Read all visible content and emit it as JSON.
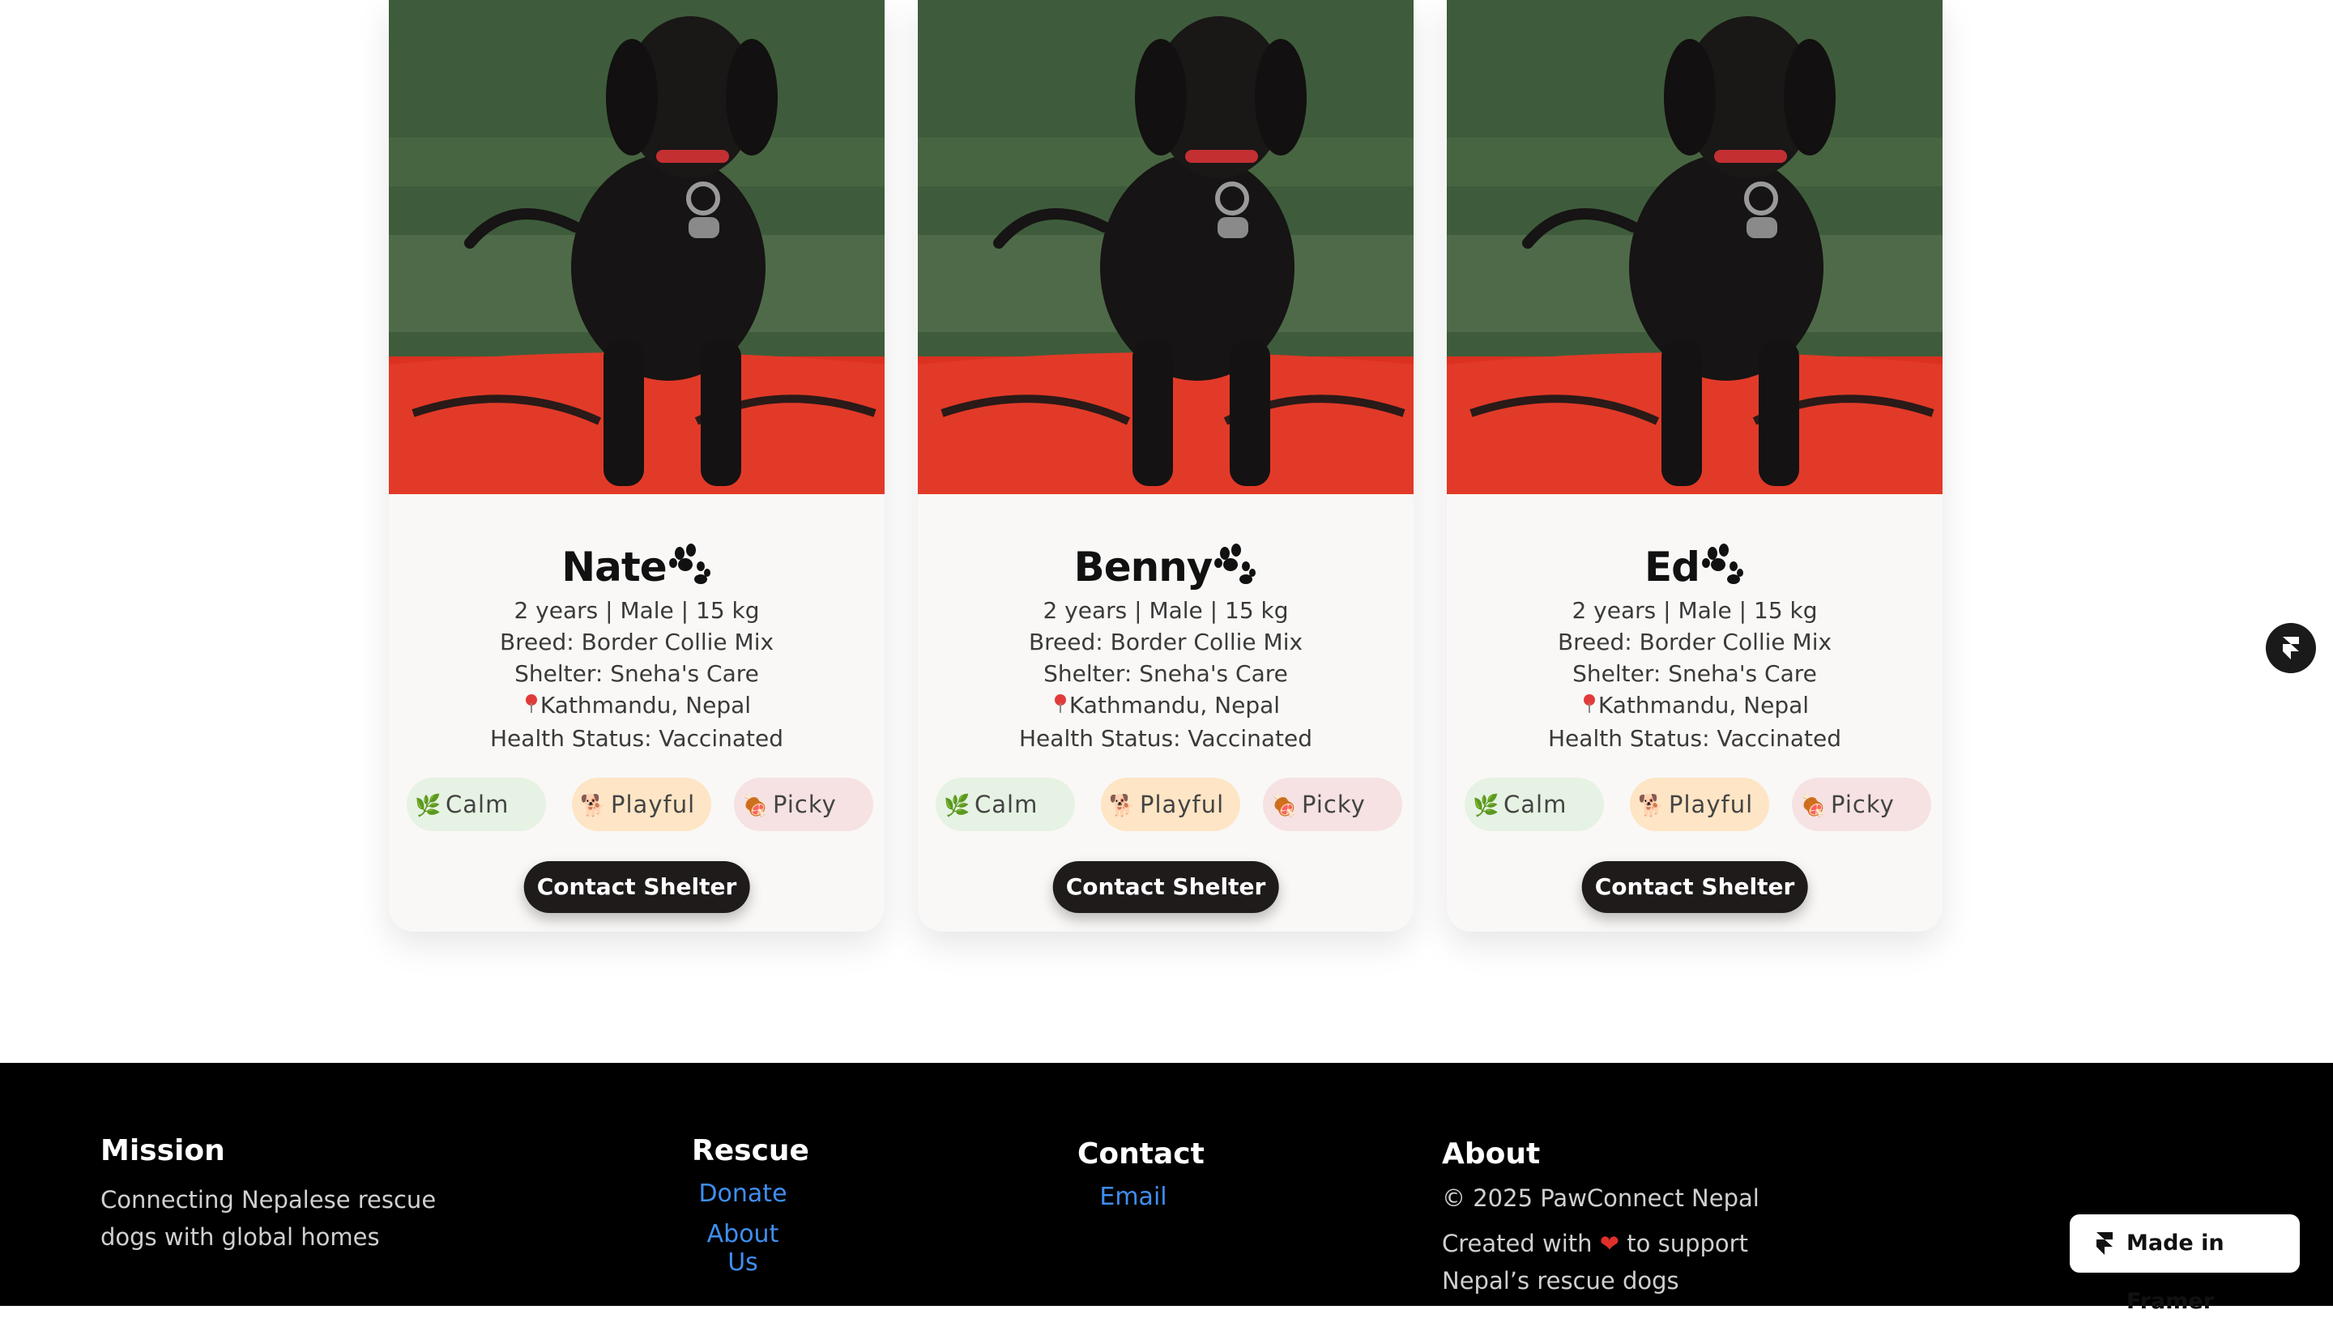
{
  "cards": [
    {
      "name": "Nate",
      "meta": "2 years | Male | 15 kg",
      "breed": "Breed: Border Collie Mix",
      "shelter": "Shelter: Sneha's Care",
      "location": "Kathmandu, Nepal",
      "health": "Health Status: Vaccinated",
      "tags": [
        "Calm",
        "Playful",
        "Picky"
      ],
      "button": "Contact Shelter"
    },
    {
      "name": "Benny",
      "meta": "2 years | Male | 15 kg",
      "breed": "Breed: Border Collie Mix",
      "shelter": "Shelter: Sneha's Care",
      "location": "Kathmandu, Nepal",
      "health": "Health Status: Vaccinated",
      "tags": [
        "Calm",
        "Playful",
        "Picky"
      ],
      "button": "Contact Shelter"
    },
    {
      "name": "Ed",
      "meta": "2 years | Male | 15 kg",
      "breed": "Breed: Border Collie Mix",
      "shelter": "Shelter: Sneha's Care",
      "location": "Kathmandu, Nepal",
      "health": "Health Status: Vaccinated",
      "tags": [
        "Calm",
        "Playful",
        "Picky"
      ],
      "button": "Contact Shelter"
    }
  ],
  "tag_icons": [
    "🌿",
    "🐕",
    "🍖"
  ],
  "icons": {
    "name": "paw-prints-icon",
    "location": "pin-icon",
    "photo": "black-puppy-on-red-kayak-photo",
    "floating": "framer-icon"
  },
  "footer": {
    "mission": {
      "heading": "Mission",
      "line1": "Connecting Nepalese rescue",
      "line2": "dogs with global homes"
    },
    "rescue": {
      "heading": "Rescue",
      "links": [
        "Donate",
        "About Us"
      ]
    },
    "contact": {
      "heading": "Contact",
      "links": [
        "Email"
      ]
    },
    "about": {
      "heading": "About",
      "copyright": "© 2025 PawConnect Nepal",
      "created_prefix": "Created with",
      "created_suffix": "to support",
      "line3": "Nepal’s rescue dogs"
    }
  },
  "badge": {
    "label": "Made in Framer"
  },
  "colors": {
    "button_bg": "#1f1b1b",
    "link": "#3f8ef0",
    "footer_bg": "#000000",
    "calm_bg": "#e6f2e3",
    "playful_bg": "#fde5c5",
    "picky_bg": "#f6e2e2"
  }
}
